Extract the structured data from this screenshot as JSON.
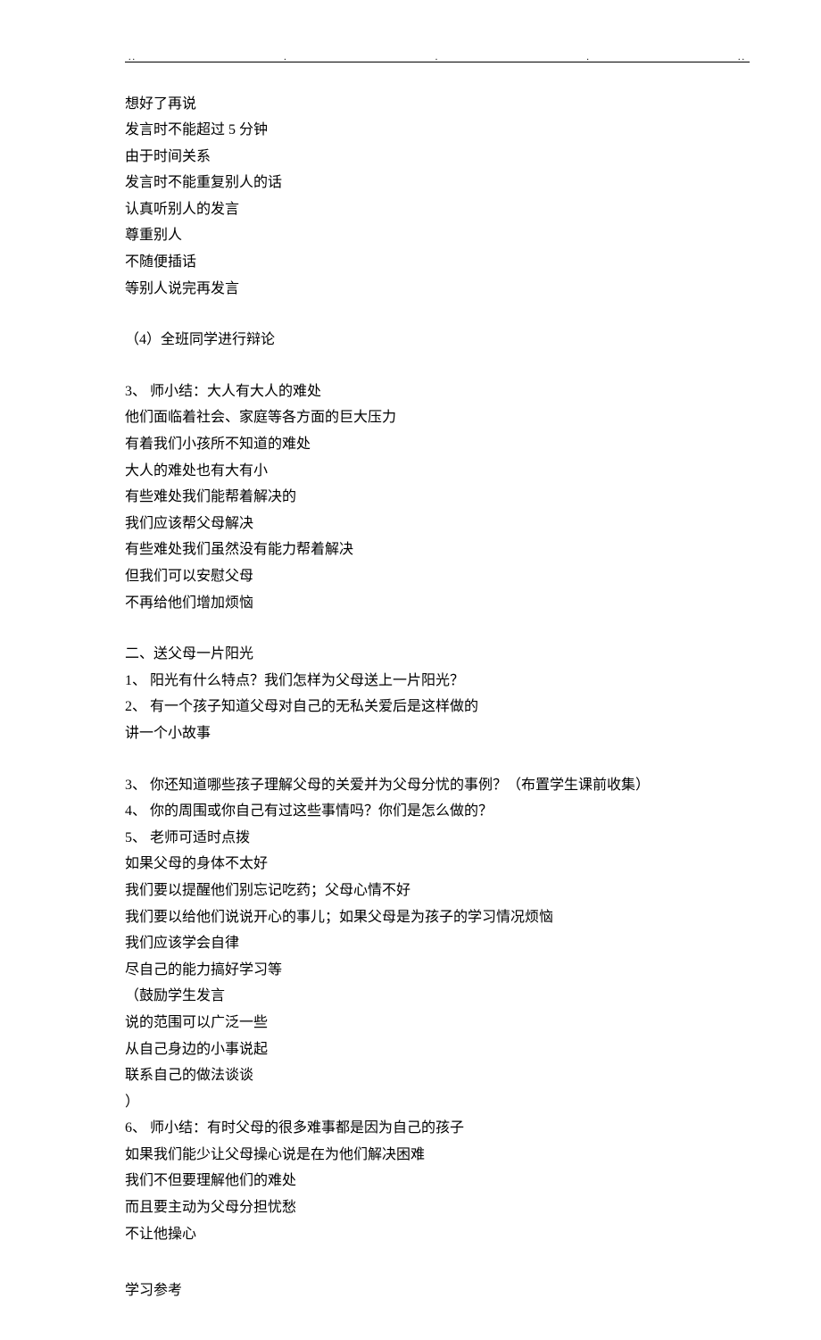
{
  "topDots": [
    "..",
    ".",
    ".",
    ".",
    ".."
  ],
  "block1": [
    "想好了再说",
    "发言时不能超过 5 分钟",
    "由于时间关系",
    "发言时不能重复别人的话",
    "认真听别人的发言",
    "尊重别人",
    "不随便插话",
    "等别人说完再发言"
  ],
  "block2": [
    "（4）全班同学进行辩论"
  ],
  "block3": [
    "3、 师小结：大人有大人的难处",
    "他们面临着社会、家庭等各方面的巨大压力",
    "有着我们小孩所不知道的难处",
    "大人的难处也有大有小",
    "有些难处我们能帮着解决的",
    "我们应该帮父母解决",
    "有些难处我们虽然没有能力帮着解决",
    "但我们可以安慰父母",
    "不再给他们增加烦恼"
  ],
  "block4": [
    "二、送父母一片阳光",
    "1、 阳光有什么特点？我们怎样为父母送上一片阳光？",
    "2、 有一个孩子知道父母对自己的无私关爱后是这样做的",
    "讲一个小故事"
  ],
  "block5": [
    "3、 你还知道哪些孩子理解父母的关爱并为父母分忧的事例？（布置学生课前收集）",
    "4、 你的周围或你自己有过这些事情吗？你们是怎么做的？",
    "5、 老师可适时点拨",
    "如果父母的身体不太好",
    "我们要以提醒他们别忘记吃药；父母心情不好",
    "我们要以给他们说说开心的事儿；如果父母是为孩子的学习情况烦恼",
    "我们应该学会自律",
    "尽自己的能力搞好学习等",
    "（鼓励学生发言",
    "说的范围可以广泛一些",
    "从自己身边的小事说起",
    "联系自己的做法谈谈",
    "）",
    "6、 师小结：有时父母的很多难事都是因为自己的孩子",
    "如果我们能少让父母操心说是在为他们解决困难",
    "我们不但要理解他们的难处",
    "而且要主动为父母分担忧愁",
    "不让他操心"
  ],
  "footer": "学习参考"
}
